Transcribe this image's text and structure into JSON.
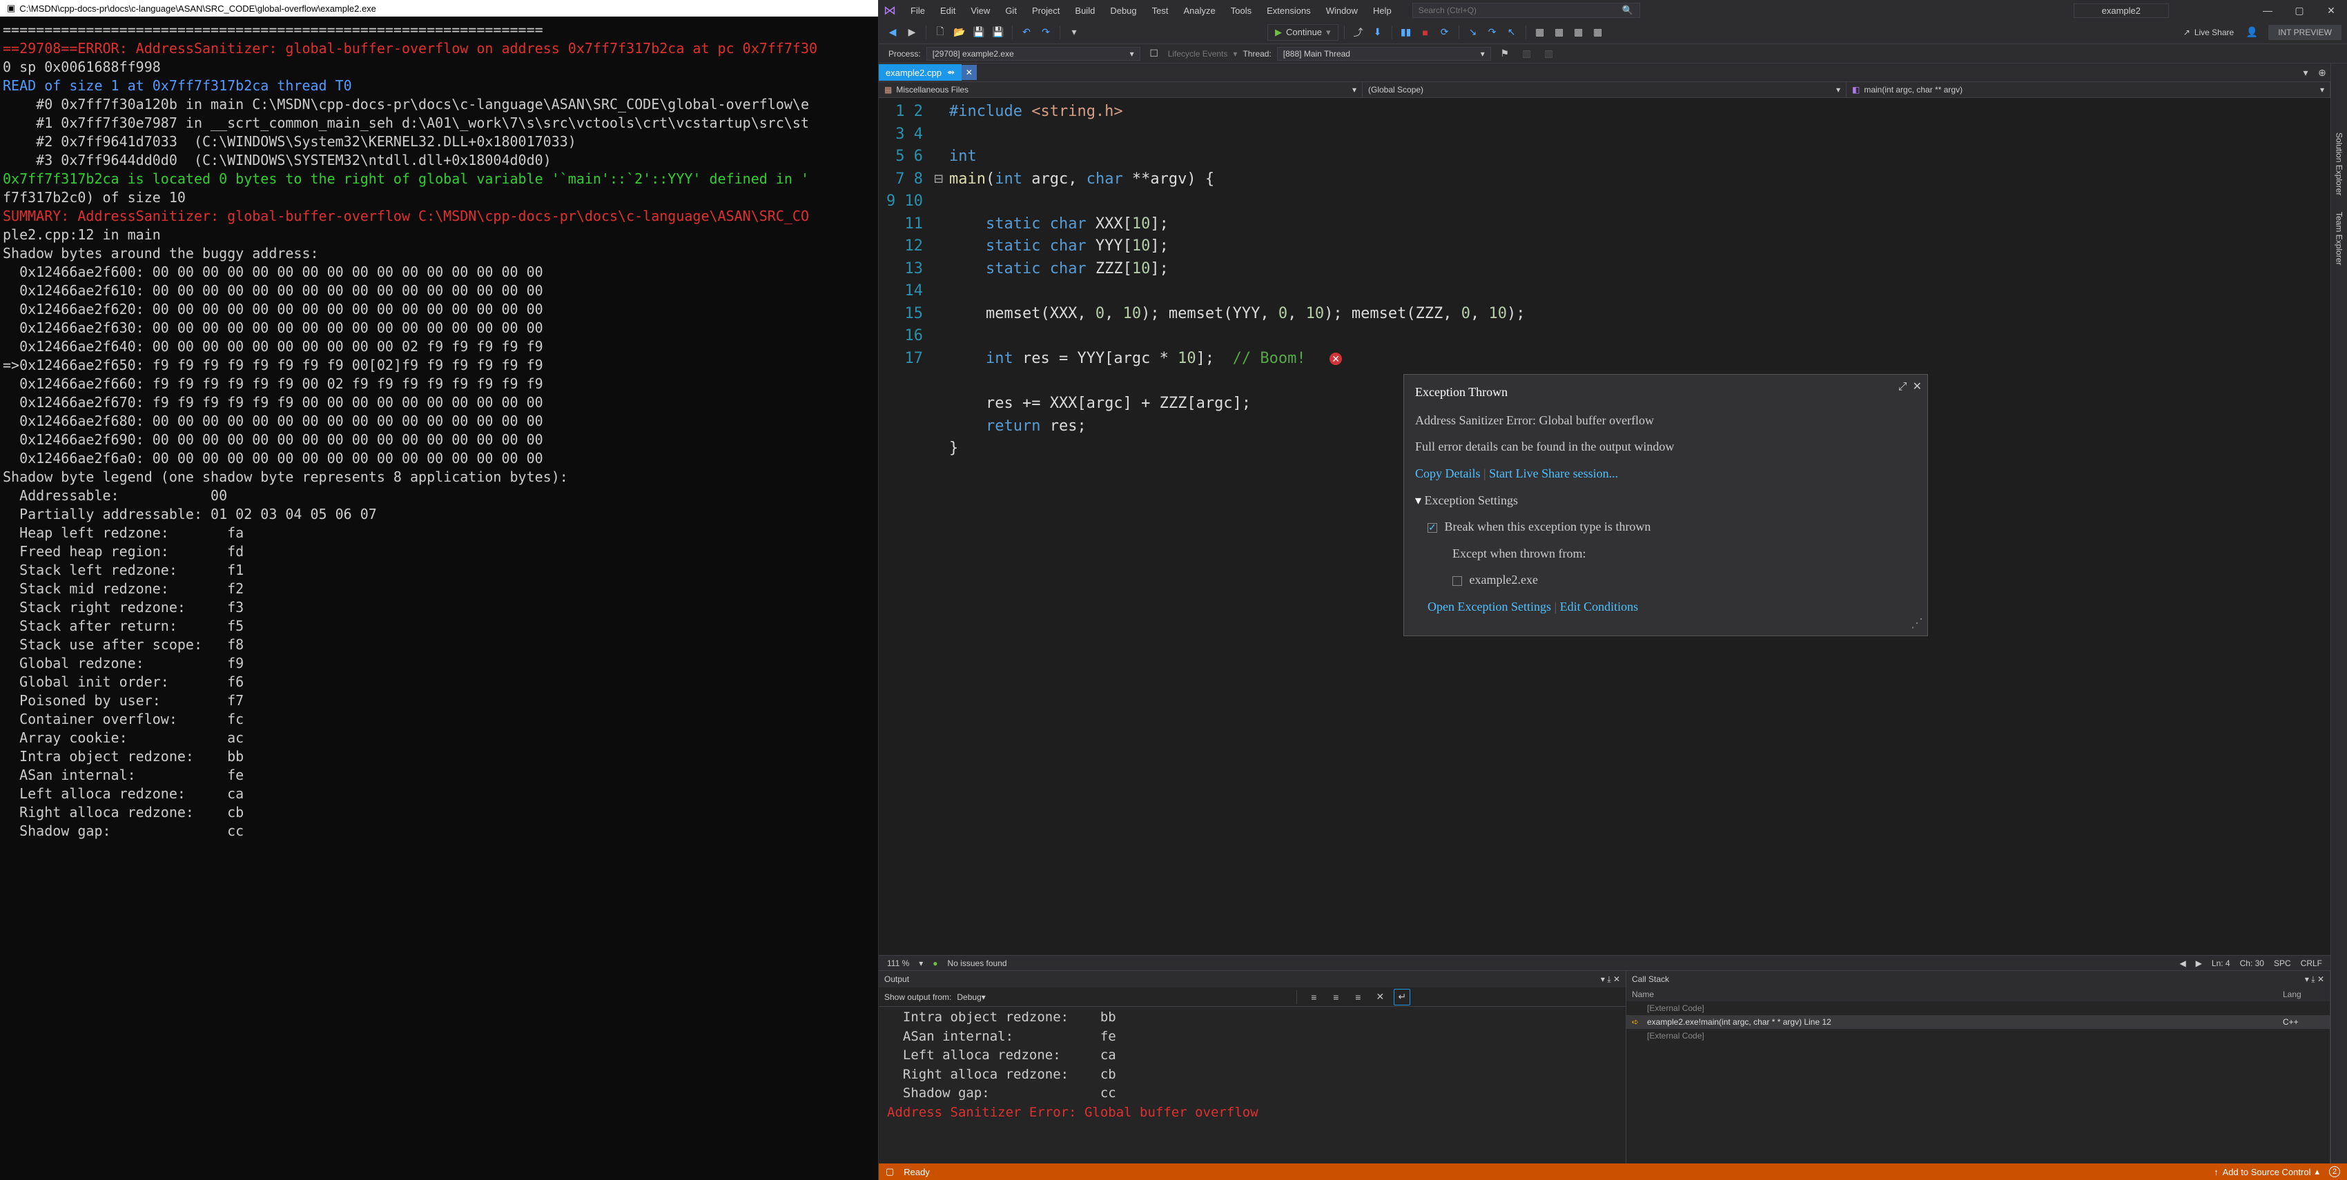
{
  "console": {
    "title": "C:\\MSDN\\cpp-docs-pr\\docs\\c-language\\ASAN\\SRC_CODE\\global-overflow\\example2.exe",
    "lines": [
      "=================================================================",
      "==29708==ERROR: AddressSanitizer: global-buffer-overflow on address 0x7ff7f317b2ca at pc 0x7ff7f30",
      "0 sp 0x0061688ff998",
      "READ of size 1 at 0x7ff7f317b2ca thread T0",
      "    #0 0x7ff7f30a120b in main C:\\MSDN\\cpp-docs-pr\\docs\\c-language\\ASAN\\SRC_CODE\\global-overflow\\e",
      "    #1 0x7ff7f30e7987 in __scrt_common_main_seh d:\\A01\\_work\\7\\s\\src\\vctools\\crt\\vcstartup\\src\\st",
      "",
      "    #2 0x7ff9641d7033  (C:\\WINDOWS\\System32\\KERNEL32.DLL+0x180017033)",
      "    #3 0x7ff9644dd0d0  (C:\\WINDOWS\\SYSTEM32\\ntdll.dll+0x18004d0d0)",
      "",
      "0x7ff7f317b2ca is located 0 bytes to the right of global variable '`main'::`2'::YYY' defined in '",
      "f7f317b2c0) of size 10",
      "SUMMARY: AddressSanitizer: global-buffer-overflow C:\\MSDN\\cpp-docs-pr\\docs\\c-language\\ASAN\\SRC_CO",
      "ple2.cpp:12 in main",
      "Shadow bytes around the buggy address:",
      "  0x12466ae2f600: 00 00 00 00 00 00 00 00 00 00 00 00 00 00 00 00",
      "  0x12466ae2f610: 00 00 00 00 00 00 00 00 00 00 00 00 00 00 00 00",
      "  0x12466ae2f620: 00 00 00 00 00 00 00 00 00 00 00 00 00 00 00 00",
      "  0x12466ae2f630: 00 00 00 00 00 00 00 00 00 00 00 00 00 00 00 00",
      "  0x12466ae2f640: 00 00 00 00 00 00 00 00 00 00 02 f9 f9 f9 f9 f9",
      "=>0x12466ae2f650: f9 f9 f9 f9 f9 f9 f9 f9 00[02]f9 f9 f9 f9 f9 f9",
      "  0x12466ae2f660: f9 f9 f9 f9 f9 f9 00 02 f9 f9 f9 f9 f9 f9 f9 f9",
      "  0x12466ae2f670: f9 f9 f9 f9 f9 f9 00 00 00 00 00 00 00 00 00 00",
      "  0x12466ae2f680: 00 00 00 00 00 00 00 00 00 00 00 00 00 00 00 00",
      "  0x12466ae2f690: 00 00 00 00 00 00 00 00 00 00 00 00 00 00 00 00",
      "  0x12466ae2f6a0: 00 00 00 00 00 00 00 00 00 00 00 00 00 00 00 00",
      "Shadow byte legend (one shadow byte represents 8 application bytes):",
      "  Addressable:           00",
      "  Partially addressable: 01 02 03 04 05 06 07",
      "  Heap left redzone:       fa",
      "  Freed heap region:       fd",
      "  Stack left redzone:      f1",
      "  Stack mid redzone:       f2",
      "  Stack right redzone:     f3",
      "  Stack after return:      f5",
      "  Stack use after scope:   f8",
      "  Global redzone:          f9",
      "  Global init order:       f6",
      "  Poisoned by user:        f7",
      "  Container overflow:      fc",
      "  Array cookie:            ac",
      "  Intra object redzone:    bb",
      "  ASan internal:           fe",
      "  Left alloca redzone:     ca",
      "  Right alloca redzone:    cb",
      "  Shadow gap:              cc"
    ]
  },
  "vs": {
    "menus": [
      "File",
      "Edit",
      "View",
      "Git",
      "Project",
      "Build",
      "Debug",
      "Test",
      "Analyze",
      "Tools",
      "Extensions",
      "Window",
      "Help"
    ],
    "search_placeholder": "Search (Ctrl+Q)",
    "doc_title": "example2",
    "continue": "Continue",
    "liveshare": "Live Share",
    "intpreview": "INT PREVIEW",
    "debugbar": {
      "process_label": "Process:",
      "process_value": "[29708] example2.exe",
      "lifecycle": "Lifecycle Events",
      "thread_label": "Thread:",
      "thread_value": "[888] Main Thread"
    },
    "tab": "example2.cpp",
    "nav": {
      "scope1": "Miscellaneous Files",
      "scope2": "(Global Scope)",
      "scope3": "main(int argc, char ** argv)"
    },
    "code": {
      "line1": "#include <string.h>",
      "line3_kw": "int",
      "line4_name": "main",
      "line4_params": "(int argc, char **argv) {",
      "line6": "static char XXX[10];",
      "line7": "static char YYY[10];",
      "line8": "static char ZZZ[10];",
      "line10": "memset(XXX, 0, 10); memset(YYY, 0, 10); memset(ZZZ, 0, 10);",
      "line12_a": "int res = YYY[argc * 10];  ",
      "line12_c": "// Boom!",
      "line14": "res += XXX[argc] + ZZZ[argc];",
      "line15": "return res;",
      "line16": "}"
    },
    "exception": {
      "title": "Exception Thrown",
      "message": "Address Sanitizer Error: Global buffer overflow",
      "details": "Full error details can be found in the output window",
      "copy": "Copy Details",
      "startls": "Start Live Share session...",
      "settings_head": "Exception Settings",
      "break": "Break when this exception type is thrown",
      "except": "Except when thrown from:",
      "exe": "example2.exe",
      "open": "Open Exception Settings",
      "edit": "Edit Conditions"
    },
    "editor_status": {
      "zoom": "111 %",
      "issues": "No issues found",
      "ln": "Ln: 4",
      "ch": "Ch: 30",
      "spc": "SPC",
      "crlf": "CRLF"
    },
    "side_tabs": [
      "Solution Explorer",
      "Team Explorer"
    ],
    "output": {
      "title": "Output",
      "from_label": "Show output from:",
      "from_value": "Debug",
      "lines": [
        "  Intra object redzone:    bb",
        "  ASan internal:           fe",
        "  Left alloca redzone:     ca",
        "  Right alloca redzone:    cb",
        "  Shadow gap:              cc",
        "Address Sanitizer Error: Global buffer overflow"
      ]
    },
    "callstack": {
      "title": "Call Stack",
      "col_name": "Name",
      "col_lang": "Lang",
      "rows": [
        {
          "name": "[External Code]",
          "lang": ""
        },
        {
          "name": "example2.exe!main(int argc, char * * argv) Line 12",
          "lang": "C++"
        },
        {
          "name": "[External Code]",
          "lang": ""
        }
      ]
    },
    "statusbar": {
      "ready": "Ready",
      "scm": "Add to Source Control"
    }
  }
}
